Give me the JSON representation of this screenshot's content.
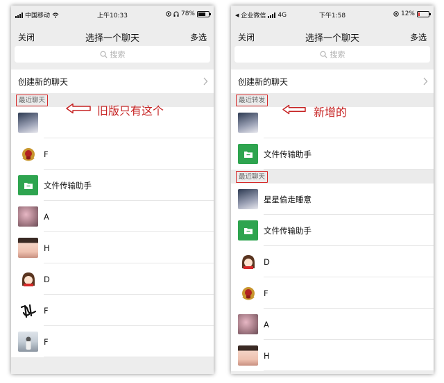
{
  "left": {
    "status": {
      "carrier": "中国移动",
      "time": "上午10:33",
      "battery": "78%"
    },
    "nav": {
      "close": "关闭",
      "title": "选择一个聊天",
      "multi": "多选"
    },
    "search_placeholder": "搜索",
    "create_chat": "创建新的聊天",
    "recent_chats_header": "最近聊天",
    "annotation": "旧版只有这个",
    "contacts": [
      {
        "name": "",
        "avatar": "avatar-night-photo"
      },
      {
        "name": "F",
        "avatar": "avatar-emblem"
      },
      {
        "name": "文件传输助手",
        "avatar": "folder-icon"
      },
      {
        "name": "A",
        "avatar": "avatar-blossom"
      },
      {
        "name": "H",
        "avatar": "avatar-girl-photo"
      },
      {
        "name": "D",
        "avatar": "avatar-cartoon-girl"
      },
      {
        "name": "F",
        "avatar": "avatar-calligraphy"
      },
      {
        "name": "F",
        "avatar": "avatar-person-photo"
      }
    ]
  },
  "right": {
    "status": {
      "carrier": "企业微信",
      "network": "4G",
      "time": "下午1:58",
      "battery": "12%"
    },
    "nav": {
      "close": "关闭",
      "title": "选择一个聊天",
      "multi": "多选"
    },
    "search_placeholder": "搜索",
    "create_chat": "创建新的聊天",
    "recent_forward_header": "最近转发",
    "annotation": "新增的",
    "forward_contacts": [
      {
        "name": "",
        "avatar": "avatar-night-photo"
      },
      {
        "name": "文件传输助手",
        "avatar": "folder-icon"
      }
    ],
    "recent_chats_header": "最近聊天",
    "contacts": [
      {
        "name": "星星偷走睡意",
        "avatar": "avatar-night-photo"
      },
      {
        "name": "文件传输助手",
        "avatar": "folder-icon"
      },
      {
        "name": "D",
        "avatar": "avatar-cartoon-girl"
      },
      {
        "name": "F",
        "avatar": "avatar-emblem"
      },
      {
        "name": "A",
        "avatar": "avatar-blossom"
      },
      {
        "name": "H",
        "avatar": "avatar-girl-photo"
      }
    ]
  },
  "colors": {
    "accent_green": "#2ea44f",
    "annotation_red": "#c62323",
    "battery_low": "#e02b2b"
  },
  "battery_levels": {
    "left": 0.78,
    "right": 0.12
  }
}
